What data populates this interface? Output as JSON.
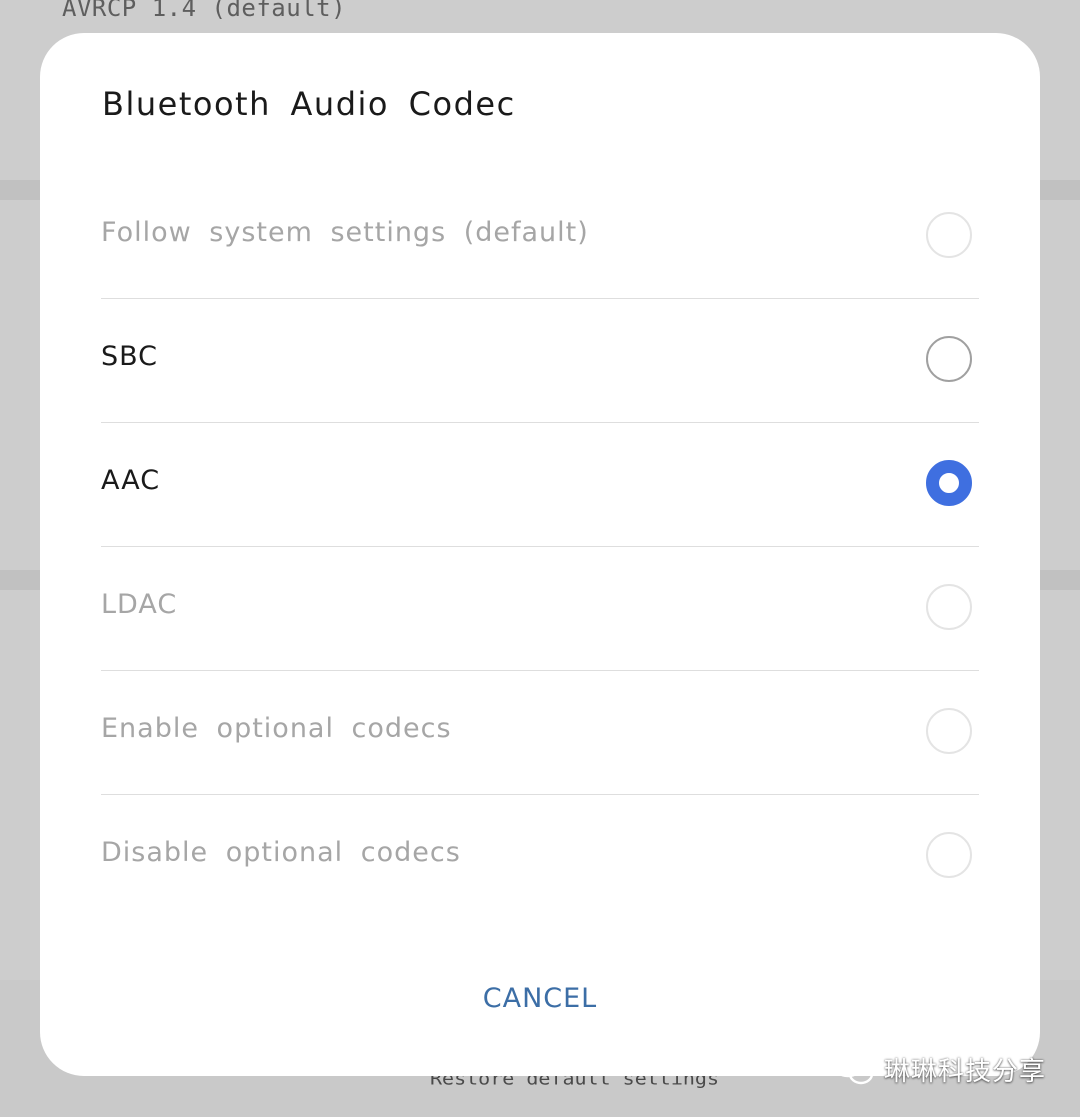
{
  "background": {
    "top_text": "AVRCP 1.4 (default)",
    "bottom_text": "Restore default settings"
  },
  "dialog": {
    "title": "Bluetooth Audio Codec",
    "options": [
      {
        "label": "Follow system settings (default)",
        "enabled": false,
        "selected": false
      },
      {
        "label": "SBC",
        "enabled": true,
        "selected": false
      },
      {
        "label": "AAC",
        "enabled": true,
        "selected": true
      },
      {
        "label": "LDAC",
        "enabled": false,
        "selected": false
      },
      {
        "label": "Enable optional codecs",
        "enabled": false,
        "selected": false
      },
      {
        "label": "Disable optional codecs",
        "enabled": false,
        "selected": false
      }
    ],
    "cancel_label": "CANCEL"
  },
  "watermark": {
    "text": "琳琳科技分享",
    "icon": "wechat-icon"
  },
  "colors": {
    "accent": "#3f6fe0",
    "cancel_text": "#3c6ea6",
    "disabled_text": "#a6a6a6",
    "overlay": "#c9c9c9"
  }
}
